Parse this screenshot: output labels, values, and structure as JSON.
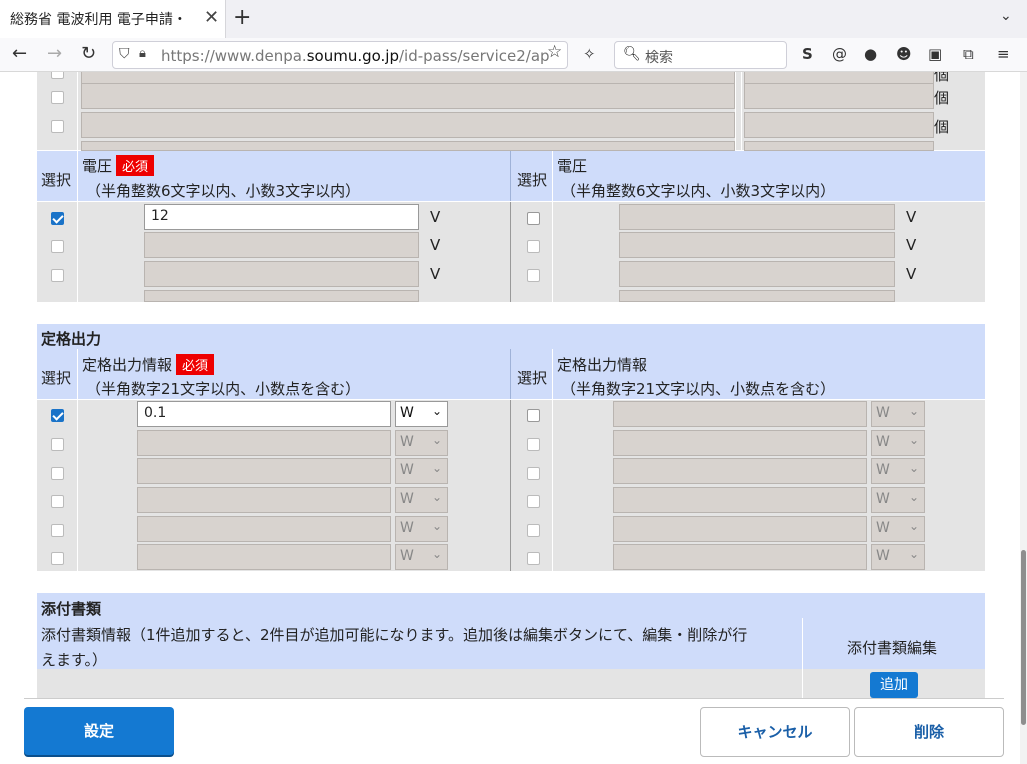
{
  "browser": {
    "tab_title": "総務省 電波利用 電子申請・",
    "url_prefix": "https://www.denpa.",
    "url_domain": "soumu.go.jp",
    "url_suffix": "/id-pass/service2/ap",
    "search_placeholder": "検索"
  },
  "prev_section": {
    "unit": "個"
  },
  "voltage": {
    "select_label": "選択",
    "label": "電圧",
    "required": "必須",
    "note": "（半角整数6文字以内、小数3文字以内）",
    "unit": "V",
    "value": "12"
  },
  "rated_output": {
    "section_title": "定格出力",
    "select_label": "選択",
    "label": "定格出力情報",
    "required": "必須",
    "note": "（半角数字21文字以内、小数点を含む）",
    "value": "0.1",
    "unit_option": "W"
  },
  "attachments": {
    "section_title": "添付書類",
    "info": "添付書類情報（1件追加すると、2件目が追加可能になります。追加後は編集ボタンにて、編集・削除が行",
    "info_line2": "えます。）",
    "edit_header": "添付書類編集",
    "add_button": "追加"
  },
  "footer": {
    "settings_button": "設定",
    "cancel_button": "キャンセル",
    "delete_button": "削除"
  }
}
